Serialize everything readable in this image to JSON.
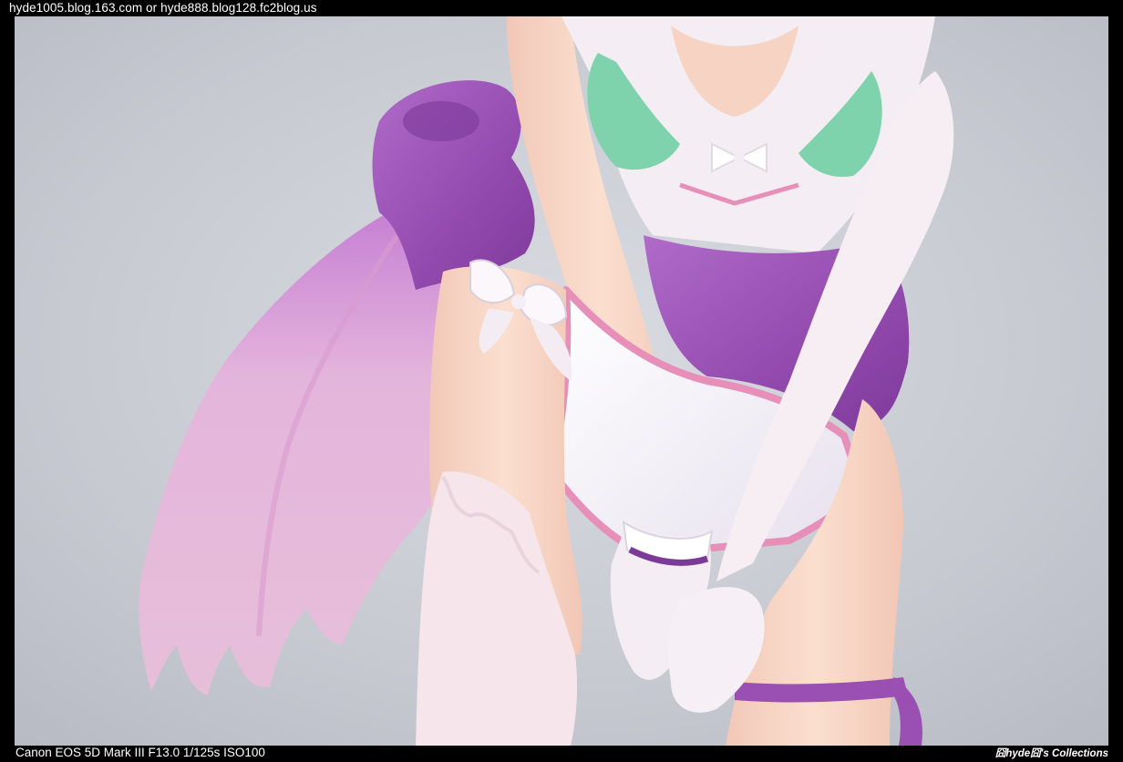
{
  "header": {
    "blog_credit": "hyde1005.blog.163.com or hyde888.blog128.fc2blog.us"
  },
  "photo": {
    "subject": "figure-closeup"
  },
  "footer": {
    "camera_info": "Canon EOS 5D Mark III F13.0 1/125s ISO100",
    "watermark": "囧hyde囧's Collections"
  },
  "colors": {
    "frame": "#000000",
    "caption_text": "#ffffff",
    "background_gray": "#c9ccd3",
    "skin": "#f6d3c2",
    "purple_sash": "#9a4fb2",
    "pink_cape": "#e7b7d7",
    "white_garment": "#f5f0f6",
    "mint_accent": "#7ed3ad",
    "pink_trim": "#e78fb8"
  }
}
